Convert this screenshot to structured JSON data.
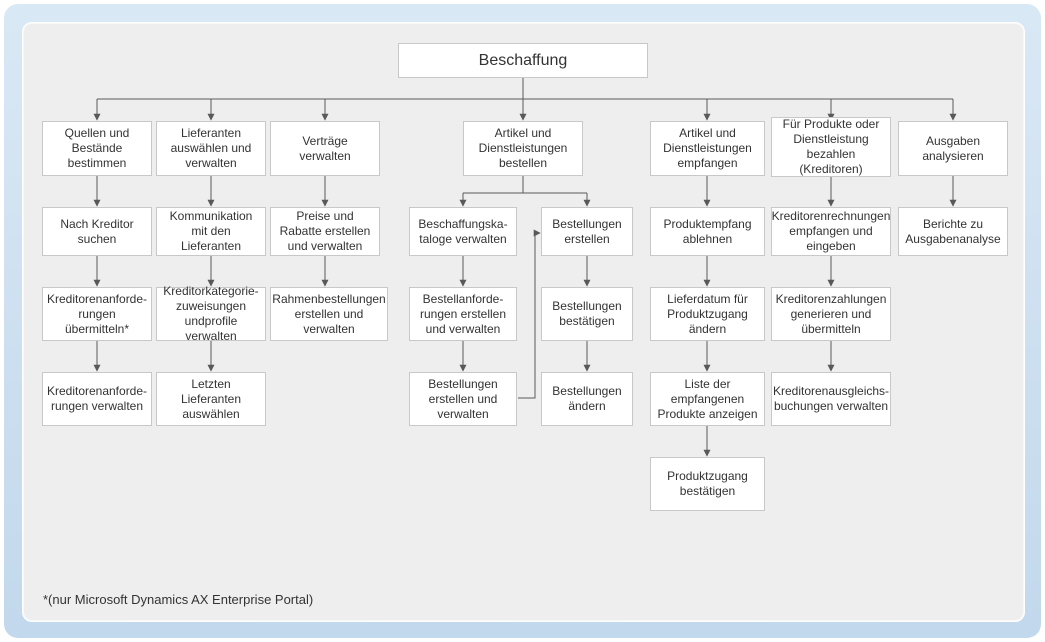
{
  "root": "Beschaffung",
  "footnote": "*(nur Microsoft Dynamics AX Enterprise Portal)",
  "cols": {
    "c1": {
      "header": "Quellen und Bestände bestimmen",
      "n1": "Nach Kreditor suchen",
      "n2": "Kreditorenanforde-rungen übermitteln*",
      "n3": "Kreditorenanforde-rungen verwalten"
    },
    "c2": {
      "header": "Lieferanten auswählen und verwalten",
      "n1": "Kommunikation mit den Lieferanten",
      "n2": "Kreditorkategorie-zuweisungen undprofile verwalten",
      "n3": "Letzten Lieferanten auswählen"
    },
    "c3": {
      "header": "Verträge verwalten",
      "n1": "Preise und Rabatte erstellen und verwalten",
      "n2": "Rahmenbestellungen erstellen und verwalten"
    },
    "c4": {
      "header": "Artikel und Dienstleistungen bestellen",
      "leftN1": "Beschaffungska-taloge verwalten",
      "leftN2": "Bestellanforde-rungen erstellen und verwalten",
      "leftN3": "Bestellungen erstellen und verwalten",
      "rightN1": "Bestellungen erstellen",
      "rightN2": "Bestellungen bestätigen",
      "rightN3": "Bestellungen ändern"
    },
    "c5": {
      "header": "Artikel und Dienstleistungen empfangen",
      "n1": "Produktempfang ablehnen",
      "n2": "Lieferdatum für Produktzugang ändern",
      "n3": "Liste der empfangenen Produkte anzeigen",
      "n4": "Produktzugang bestätigen"
    },
    "c6": {
      "header": "Für Produkte oder Dienstleistung bezahlen (Kreditoren)",
      "n1": "Kreditorenrechnungen empfangen und eingeben",
      "n2": "Kreditorenzahlungen generieren und übermitteln",
      "n3": "Kreditorenausgleichs-buchungen verwalten"
    },
    "c7": {
      "header": "Ausgaben analysieren",
      "n1": "Berichte zu Ausgabenanalyse"
    }
  }
}
